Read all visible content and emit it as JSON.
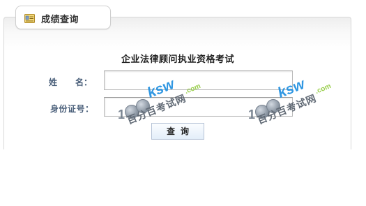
{
  "tab": {
    "title": "成绩查询",
    "icon": "id-card-icon"
  },
  "form": {
    "title": "企业法律顾问执业资格考试",
    "name_label": "姓",
    "name_label_2": "名：",
    "name_value": "",
    "id_label": "身份证号：",
    "id_value": "",
    "submit_label": "查询"
  },
  "watermark": {
    "brand": "ksw",
    "domain": ".com",
    "cn_text": "百分百考试网",
    "digits": "1"
  },
  "colors": {
    "label_text": "#4a5f7a",
    "watermark_blue": "#1f8fe0",
    "watermark_green": "#8fc93a",
    "button_border": "#b6c3d6"
  }
}
